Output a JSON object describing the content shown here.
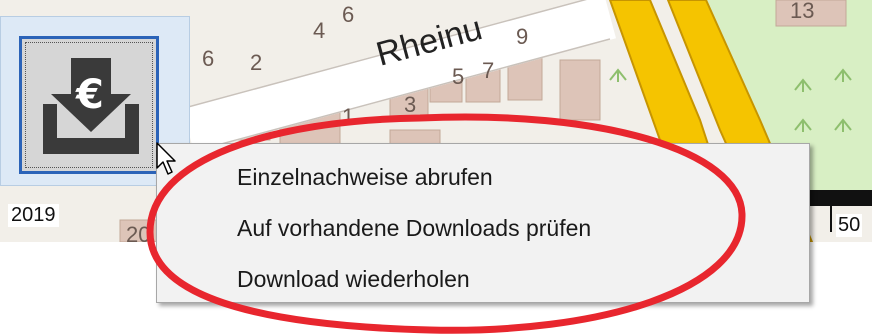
{
  "map": {
    "street_name": "Rheinu",
    "house_numbers": [
      "4",
      "6",
      "2",
      "6",
      "3",
      "5",
      "7",
      "9",
      "1",
      "13",
      "20"
    ]
  },
  "toolbar": {
    "download_button_icon": "euro-download-icon",
    "download_button_symbol": "€"
  },
  "status": {
    "year": "2019",
    "scale_value": "50"
  },
  "context_menu": {
    "items": [
      {
        "label": "Einzelnachweise abrufen"
      },
      {
        "label": "Auf vorhandene Downloads prüfen"
      },
      {
        "label": "Download wiederholen"
      }
    ]
  },
  "colors": {
    "highlight": "#e8262e",
    "road_yellow": "#f5c400",
    "panel_blue": "#dde9f6",
    "button_border": "#2b63b8",
    "map_background": "#f2efe9",
    "building": "#ddc4b8",
    "park_green": "#d8efc4"
  }
}
